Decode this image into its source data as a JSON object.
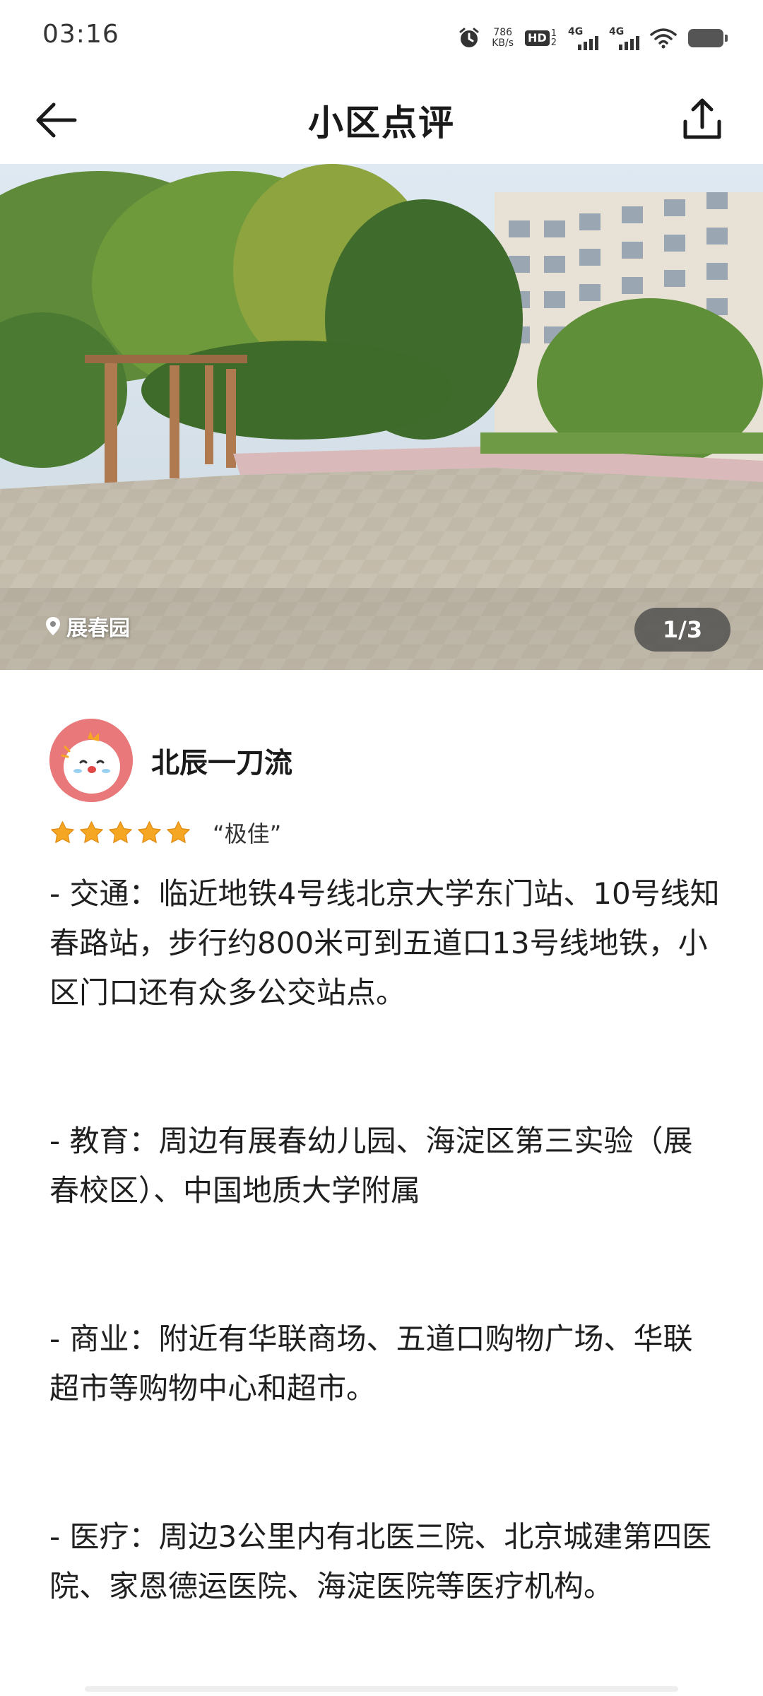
{
  "status_bar": {
    "time": "03:16",
    "net_speed_value": "786",
    "net_speed_unit": "KB/s",
    "hd_label": "HD",
    "hd_sub1": "1",
    "hd_sub2": "2",
    "sim1_label": "4G",
    "sim2_label": "4G"
  },
  "header": {
    "title": "小区点评"
  },
  "photo": {
    "location": "展春园",
    "counter": "1/3"
  },
  "review": {
    "author": "北辰一刀流",
    "rating_stars": 5,
    "rating_label": "“极佳”",
    "paragraphs": [
      "- 交通：临近地铁4号线北京大学东门站、10号线知春路站，步行约800米可到五道口13号线地铁，小区门口还有众多公交站点。",
      "- 教育：周边有展春幼儿园、海淀区第三实验（展春校区）、中国地质大学附属",
      "- 商业：附近有华联商场、五道口购物广场、华联超市等购物中心和超市。",
      "- 医疗：周边3公里内有北医三院、北京城建第四医院、家恩德运医院、海淀医院等医疗机构。"
    ]
  },
  "colors": {
    "star": "#f5a623",
    "avatar_bg": "#e9787a",
    "text": "#1f1f1f"
  }
}
